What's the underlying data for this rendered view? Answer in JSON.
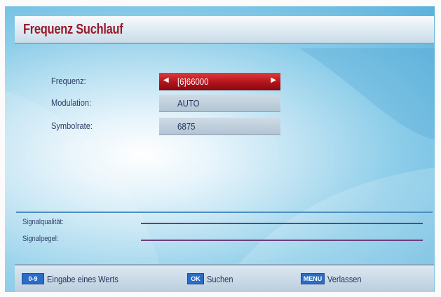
{
  "title": "Frequenz Suchlauf",
  "rows": [
    {
      "label": "Frequenz:",
      "value": "[6]66000",
      "selected": true
    },
    {
      "label": "Modulation:",
      "value": "AUTO",
      "selected": false
    },
    {
      "label": "Symbolrate:",
      "value": "6875",
      "selected": false
    }
  ],
  "arrows": {
    "left": "◀",
    "right": "▶"
  },
  "signal": {
    "quality_label": "Signalqualität:",
    "level_label": "Signalpegel:"
  },
  "footer": {
    "items": [
      {
        "key": "0-9",
        "label": "Eingabe eines Werts",
        "icon": "number-keys-icon"
      },
      {
        "key": "OK",
        "label": "Suchen",
        "icon": "ok-key-icon"
      },
      {
        "key": "MENU",
        "label": "Verlassen",
        "icon": "menu-key-icon"
      }
    ]
  },
  "colors": {
    "title": "#9a1a2a",
    "selected_row": "#b4141c",
    "text": "#24345e",
    "key": "#2a6cc8",
    "signal_line": "#6c3f7d"
  }
}
